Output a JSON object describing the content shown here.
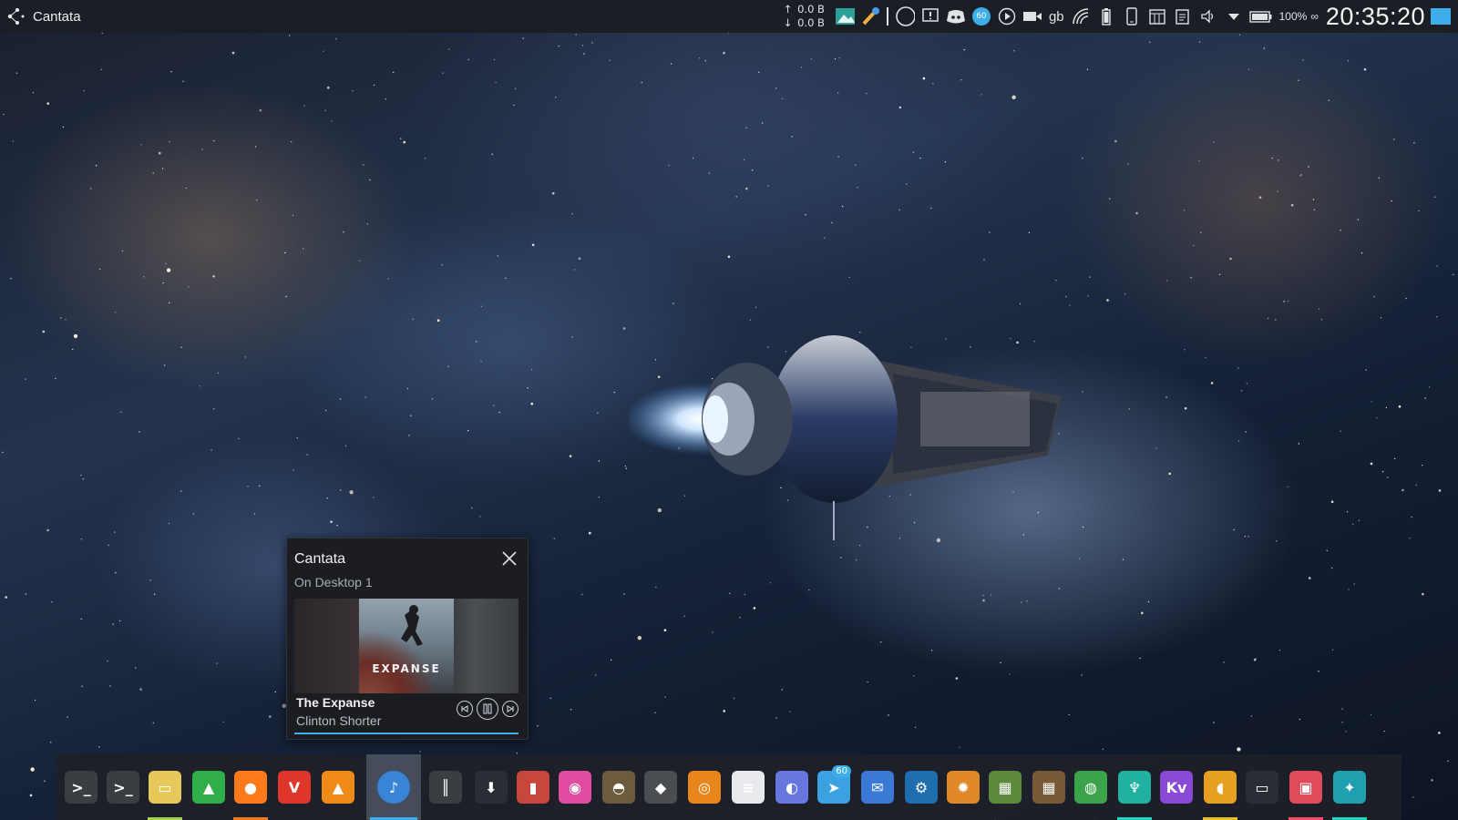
{
  "top_panel": {
    "active_window_title": "Cantata",
    "network": {
      "upload_arrow": "↑",
      "upload": "0.0 B",
      "download_arrow": "↓",
      "download": "0.0 B"
    },
    "tray_items": [
      "image-viewer-icon",
      "color-picker-icon",
      "circle-icon",
      "notification-warning-icon",
      "discord-icon",
      "telegram-icon",
      "media-play-icon",
      "camera-icon",
      "keyboard-layout",
      "wifi-icon",
      "battery-small-icon",
      "phone-icon",
      "calculator-icon",
      "clipboard-icon",
      "volume-icon",
      "expand-tray-icon",
      "battery-icon"
    ],
    "telegram_badge": "60",
    "keyboard_layout": "gb",
    "battery_percent": "100%",
    "battery_extra": "∞",
    "clock": "20:35:20"
  },
  "tooltip": {
    "title": "Cantata",
    "subtitle": "On Desktop 1",
    "album_art_text": "EXPANSE",
    "track_title": "The Expanse",
    "track_artist": "Clinton Shorter",
    "progress": 1.0
  },
  "dock": {
    "items": [
      {
        "name": "terminal-1",
        "color": "#3a3d42",
        "glyph": ">_"
      },
      {
        "name": "terminal-2",
        "color": "#3a3d42",
        "glyph": ">_"
      },
      {
        "name": "file-manager",
        "color": "#e7c85a",
        "glyph": "▭",
        "indicator": "#a3d14a"
      },
      {
        "name": "system-monitor",
        "color": "#2fae4a",
        "glyph": "▲"
      },
      {
        "name": "firefox",
        "color": "#ff7a1a",
        "glyph": "●",
        "indicator": "#ff7a1a"
      },
      {
        "name": "vivaldi",
        "color": "#e0352b",
        "glyph": "V"
      },
      {
        "name": "vlc",
        "color": "#f08a16",
        "glyph": "▲"
      },
      {
        "name": "cantata",
        "color": "#3a84d6",
        "glyph": "♪",
        "active": true,
        "indicator": "#3daee9"
      },
      {
        "name": "audio-mixer",
        "color": "#3a3d42",
        "glyph": "║"
      },
      {
        "name": "downloader",
        "color": "#2a2d33",
        "glyph": "⬇"
      },
      {
        "name": "archive-manager",
        "color": "#c9473a",
        "glyph": "▮"
      },
      {
        "name": "color-app",
        "color": "#e04da0",
        "glyph": "◉"
      },
      {
        "name": "gimp",
        "color": "#6e5a3e",
        "glyph": "◓"
      },
      {
        "name": "inkscape",
        "color": "#4a4d52",
        "glyph": "◆"
      },
      {
        "name": "blender",
        "color": "#e8861c",
        "glyph": "◎"
      },
      {
        "name": "document-viewer",
        "color": "#e8eaed",
        "glyph": "≡"
      },
      {
        "name": "discord",
        "color": "#6876e0",
        "glyph": "◐"
      },
      {
        "name": "telegram",
        "color": "#3aa2e0",
        "glyph": "➤",
        "badge": "60"
      },
      {
        "name": "thunderbird",
        "color": "#3a7ad6",
        "glyph": "✉"
      },
      {
        "name": "steam",
        "color": "#1f6fb0",
        "glyph": "⚙"
      },
      {
        "name": "settings",
        "color": "#e0892a",
        "glyph": "✹"
      },
      {
        "name": "minecraft",
        "color": "#5c8a3a",
        "glyph": "▦"
      },
      {
        "name": "minecraft-2",
        "color": "#7a5a36",
        "glyph": "▦"
      },
      {
        "name": "android-studio",
        "color": "#3ba34a",
        "glyph": "◍"
      },
      {
        "name": "gitkraken",
        "color": "#1fb2a0",
        "glyph": "♆",
        "indicator": "#1fd6c0"
      },
      {
        "name": "kdenlive",
        "color": "#8a4ad6",
        "glyph": "Kv"
      },
      {
        "name": "osu",
        "color": "#e8a020",
        "glyph": "◖",
        "indicator": "#e8c020"
      },
      {
        "name": "screen",
        "color": "#2a2d33",
        "glyph": "▭"
      },
      {
        "name": "photo-app",
        "color": "#e04a5a",
        "glyph": "▣",
        "indicator": "#ff4a6a"
      },
      {
        "name": "browser-round",
        "color": "#1fa0b0",
        "glyph": "✦",
        "indicator": "#1fd6c0"
      }
    ]
  }
}
